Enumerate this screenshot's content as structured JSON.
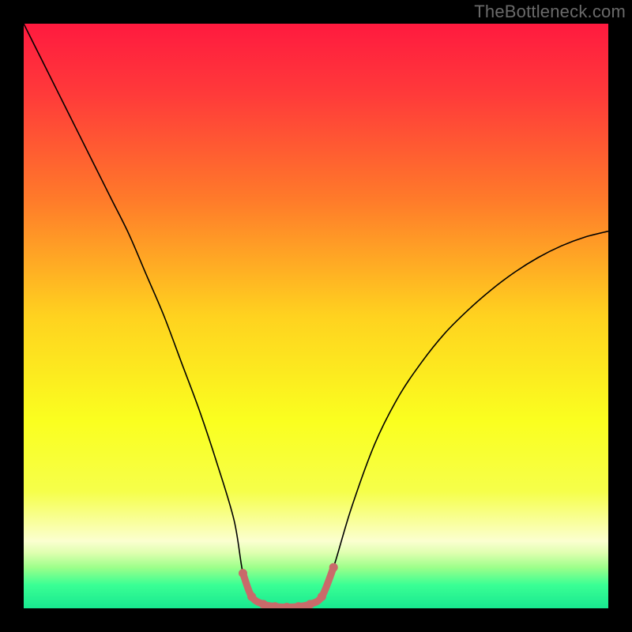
{
  "watermark": "TheBottleneck.com",
  "chart_data": {
    "type": "line",
    "title": "",
    "xlabel": "",
    "ylabel": "",
    "xlim": [
      0,
      100
    ],
    "ylim": [
      0,
      100
    ],
    "background_gradient": {
      "stops": [
        {
          "offset": 0.0,
          "color": "#ff1a3f"
        },
        {
          "offset": 0.12,
          "color": "#ff3a3a"
        },
        {
          "offset": 0.3,
          "color": "#ff7a2a"
        },
        {
          "offset": 0.5,
          "color": "#ffd21f"
        },
        {
          "offset": 0.68,
          "color": "#faff1f"
        },
        {
          "offset": 0.8,
          "color": "#f6ff4a"
        },
        {
          "offset": 0.885,
          "color": "#fbffd0"
        },
        {
          "offset": 0.905,
          "color": "#dfffb0"
        },
        {
          "offset": 0.93,
          "color": "#9dff8a"
        },
        {
          "offset": 0.96,
          "color": "#3aff94"
        },
        {
          "offset": 1.0,
          "color": "#18e890"
        }
      ]
    },
    "series": [
      {
        "name": "bottleneck-curve",
        "color": "#000000",
        "width": 1.6,
        "x": [
          0,
          3,
          6,
          9,
          12,
          15,
          18,
          21,
          24,
          27,
          30,
          33,
          36,
          37.5,
          39,
          41,
          43,
          45,
          47,
          49,
          51,
          53,
          56,
          60,
          64,
          68,
          72,
          76,
          80,
          84,
          88,
          92,
          96,
          100
        ],
        "y_pct": [
          100,
          94,
          88,
          82,
          76,
          70,
          64,
          57,
          50,
          42,
          34,
          25,
          15,
          6,
          2,
          0.7,
          0.3,
          0.2,
          0.3,
          0.7,
          2,
          7,
          17,
          28,
          36,
          42,
          47,
          51,
          54.5,
          57.5,
          60,
          62,
          63.5,
          64.5
        ]
      }
    ],
    "highlight": {
      "name": "optimal-band",
      "color": "#c96a6a",
      "line_width": 9,
      "dot_radius": 5.5,
      "x": [
        37.5,
        39,
        41,
        43,
        45,
        47,
        49,
        51,
        53
      ],
      "y_pct": [
        6,
        2,
        0.7,
        0.3,
        0.2,
        0.3,
        0.7,
        2,
        7
      ]
    }
  }
}
